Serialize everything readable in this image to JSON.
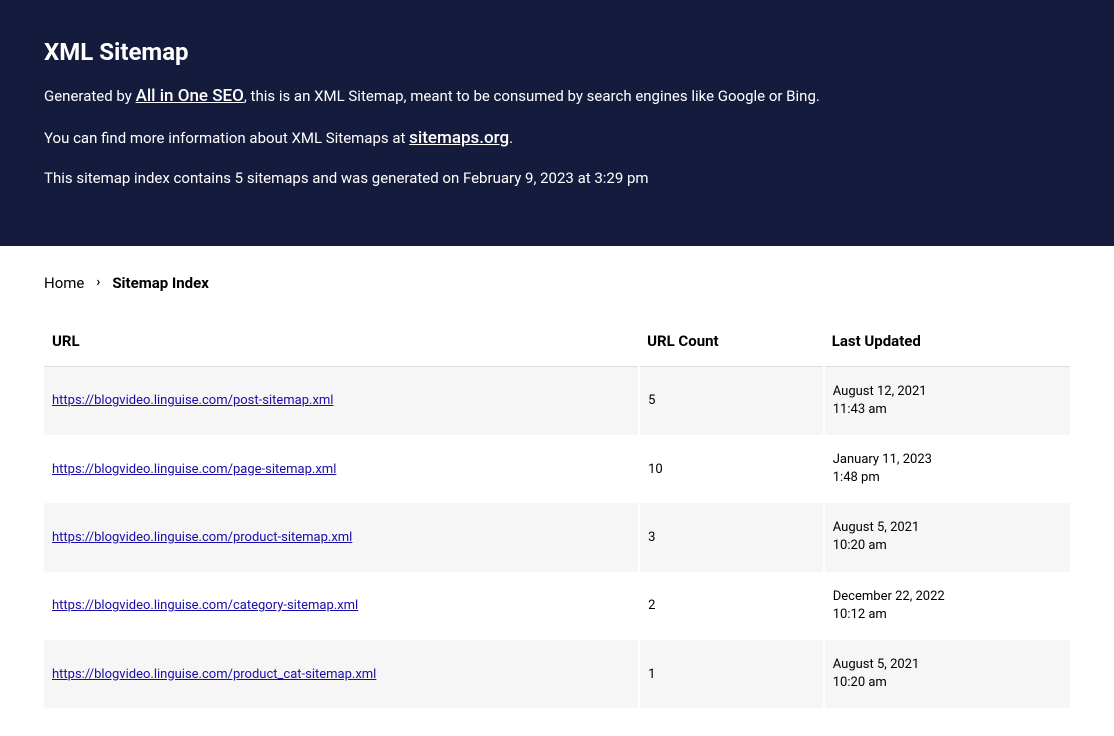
{
  "header": {
    "title": "XML Sitemap",
    "line1_prefix": "Generated by ",
    "line1_link": "All in One SEO",
    "line1_suffix": ", this is an XML Sitemap, meant to be consumed by search engines like Google or Bing.",
    "line2_prefix": "You can find more information about XML Sitemaps at ",
    "line2_link": "sitemaps.org",
    "line2_suffix": ".",
    "line3": "This sitemap index contains 5 sitemaps and was generated on February 9, 2023 at 3:29 pm"
  },
  "breadcrumb": {
    "home": "Home",
    "current": "Sitemap Index"
  },
  "table": {
    "columns": {
      "url": "URL",
      "count": "URL Count",
      "updated": "Last Updated"
    },
    "rows": [
      {
        "url": "https://blogvideo.linguise.com/post-sitemap.xml",
        "count": "5",
        "date": "August 12, 2021",
        "time": "11:43 am"
      },
      {
        "url": "https://blogvideo.linguise.com/page-sitemap.xml",
        "count": "10",
        "date": "January 11, 2023",
        "time": "1:48 pm"
      },
      {
        "url": "https://blogvideo.linguise.com/product-sitemap.xml",
        "count": "3",
        "date": "August 5, 2021",
        "time": "10:20 am"
      },
      {
        "url": "https://blogvideo.linguise.com/category-sitemap.xml",
        "count": "2",
        "date": "December 22, 2022",
        "time": "10:12 am"
      },
      {
        "url": "https://blogvideo.linguise.com/product_cat-sitemap.xml",
        "count": "1",
        "date": "August 5, 2021",
        "time": "10:20 am"
      }
    ]
  }
}
